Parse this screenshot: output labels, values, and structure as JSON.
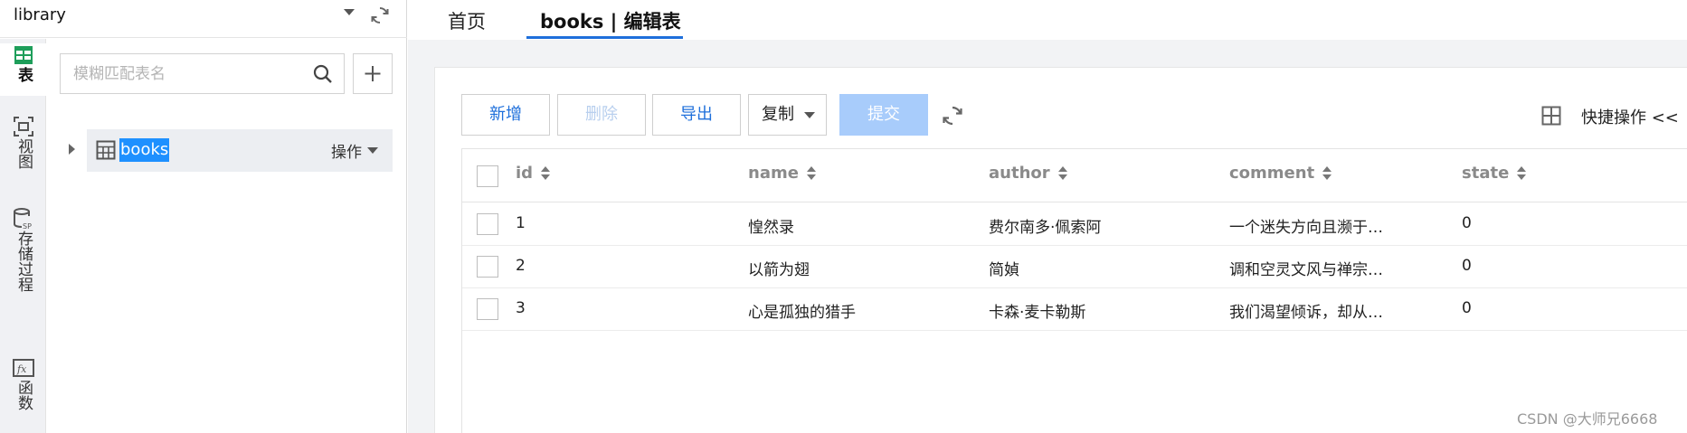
{
  "db": {
    "name": "library"
  },
  "rail": {
    "items": [
      {
        "label": "表",
        "icon": "table-icon",
        "active": true
      },
      {
        "label": "视图",
        "icon": "view-icon"
      },
      {
        "label": "存储过程",
        "icon": "stored-procedure-icon"
      },
      {
        "label": "函数",
        "icon": "function-icon"
      }
    ]
  },
  "search": {
    "placeholder": "模糊匹配表名",
    "value": ""
  },
  "tree": {
    "items": [
      {
        "label": "books",
        "action": "操作"
      }
    ]
  },
  "tabs": [
    {
      "label": "首页"
    },
    {
      "label": "books | 编辑表",
      "active": true
    }
  ],
  "toolbar": {
    "add": "新增",
    "delete": "删除",
    "export": "导出",
    "copy": "复制",
    "submit": "提交",
    "quick_ops": "快捷操作 <<"
  },
  "table": {
    "columns": [
      "id",
      "name",
      "author",
      "comment",
      "state"
    ],
    "rows": [
      {
        "id": "1",
        "name": "惶然录",
        "author": "费尔南多·佩索阿",
        "comment": "一个迷失方向且濒于…",
        "state": "0"
      },
      {
        "id": "2",
        "name": "以箭为翅",
        "author": "简媜",
        "comment": "调和空灵文风与禅宗…",
        "state": "0"
      },
      {
        "id": "3",
        "name": "心是孤独的猎手",
        "author": "卡森·麦卡勒斯",
        "comment": "我们渴望倾诉，却从…",
        "state": "0"
      }
    ]
  },
  "watermark": "CSDN @大师兄6668",
  "colors": {
    "accent": "#1e6fdb",
    "submit_disabled": "#a8ccfb",
    "selection": "#1e90ff",
    "rail_bg": "#f0f1f4"
  }
}
